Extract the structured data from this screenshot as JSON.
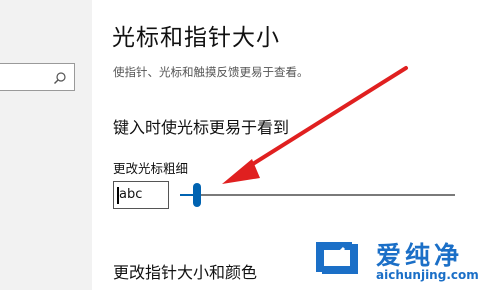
{
  "sidebar": {
    "search": {
      "placeholder": "",
      "icon": "search-icon"
    }
  },
  "page": {
    "title": "光标和指针大小",
    "subtitle": "使指针、光标和触摸反馈更易于查看。",
    "section_cursor": {
      "heading": "键入时使光标更易于看到",
      "slider_label": "更改光标粗细",
      "preview_text": "abc",
      "thickness_level": 0.04
    },
    "section_pointer": {
      "heading": "更改指针大小和颜色"
    }
  },
  "watermark": {
    "brand": "爱纯净",
    "url": "aichunjing.com"
  },
  "colors": {
    "accent": "#0063b1",
    "annotation_arrow": "#e02020",
    "watermark": "#1b6fc7"
  }
}
